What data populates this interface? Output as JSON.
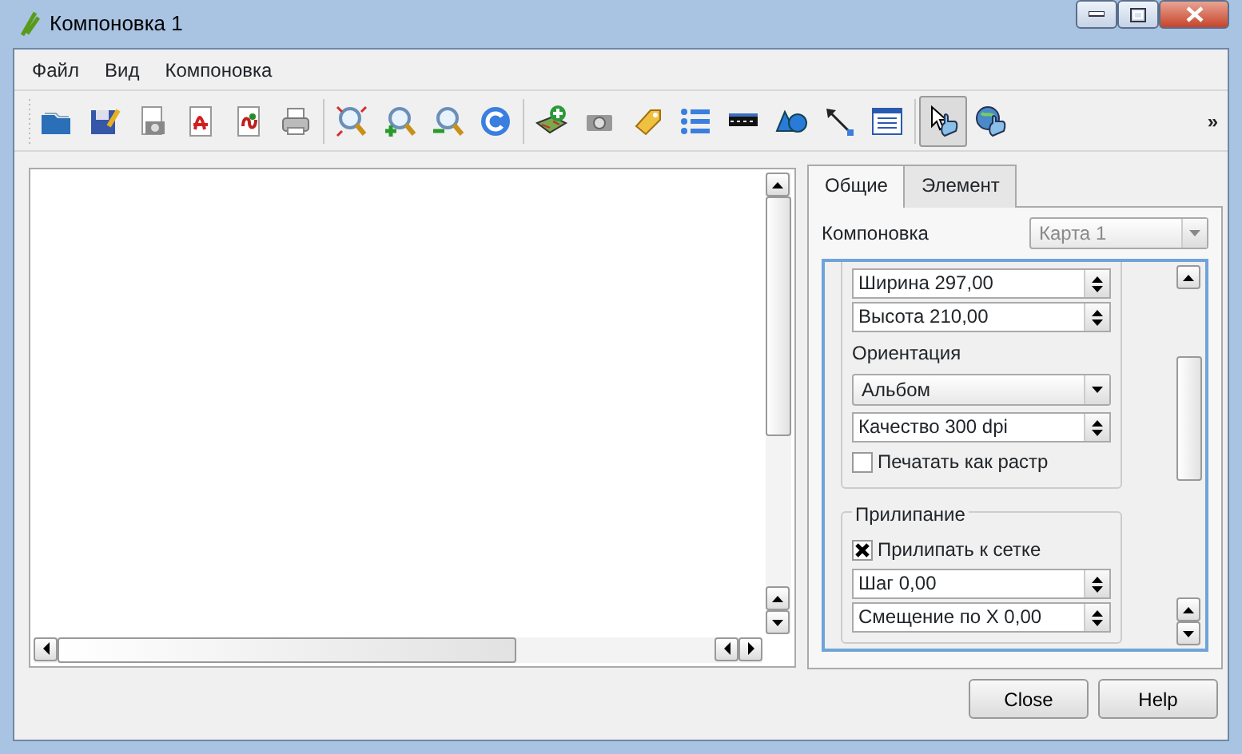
{
  "window": {
    "title": "Компоновка 1"
  },
  "menu": [
    {
      "label": "Файл"
    },
    {
      "label": "Вид"
    },
    {
      "label": "Компоновка"
    }
  ],
  "toolbar": {
    "tools": [
      {
        "selected": false
      },
      {
        "selected": false
      },
      {
        "selected": false
      },
      {
        "selected": false
      },
      {
        "selected": false
      },
      {
        "selected": false
      },
      {
        "selected": false
      },
      {
        "selected": false
      },
      {
        "selected": false
      },
      {
        "selected": false
      },
      {
        "selected": false
      },
      {
        "selected": false
      },
      {
        "selected": false
      },
      {
        "selected": false
      },
      {
        "selected": false
      },
      {
        "selected": false
      },
      {
        "selected": false
      },
      {
        "selected": false
      },
      {
        "selected": true
      },
      {
        "selected": false
      }
    ],
    "overflow": "»"
  },
  "tabs": [
    {
      "label": "Общие",
      "selected": true
    },
    {
      "label": "Элемент",
      "selected": false
    }
  ],
  "composition": {
    "label": "Компоновка",
    "value": "Карта 1",
    "disabled": true
  },
  "groups": [
    {
      "items": [
        {
          "kind": "spin",
          "value": "Ширина 297,00"
        },
        {
          "kind": "spin",
          "value": "Высота 210,00"
        },
        {
          "kind": "label",
          "text": "Ориентация"
        },
        {
          "kind": "combo",
          "value": "Альбом"
        },
        {
          "kind": "spin",
          "value": "Качество 300 dpi"
        },
        {
          "kind": "checkbox",
          "label": "Печатать как растр",
          "checked": false
        }
      ]
    },
    {
      "title": "Прилипание",
      "items": [
        {
          "kind": "checkbox",
          "label": "Прилипать к сетке",
          "checked": true
        },
        {
          "kind": "spin",
          "value": "Шаг 0,00"
        },
        {
          "kind": "spin",
          "value": "Смещение по X 0,00"
        }
      ]
    }
  ],
  "buttons": [
    {
      "label": "Close"
    },
    {
      "label": "Help"
    }
  ]
}
